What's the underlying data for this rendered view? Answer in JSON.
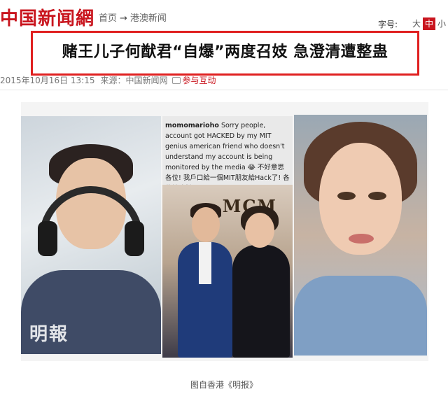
{
  "site": {
    "logo": "中国新闻網"
  },
  "breadcrumb": {
    "home": "首页",
    "separator": "→",
    "section": "港澳新闻"
  },
  "font_size": {
    "label": "字号:",
    "options": [
      "大",
      "中",
      "小"
    ],
    "selected": "中"
  },
  "article": {
    "headline": "赌王儿子何猷君“自爆”两度召妓 急澄清遭整蛊",
    "date": "2015年10月16日 13:15",
    "source": "来源：中国新闻网",
    "comment_link": "参与互动"
  },
  "image": {
    "instagram_user": "momomarioho",
    "instagram_caption": "Sorry people, account got HACKED by my MIT genius american friend who doesn't understand my account is being monitored by the media 😂 不好意思各位! 我戶口給一個MIT朋友給Hack了! 各位請冷靜! #MIT",
    "backdrop_logo": "MCM",
    "watermark": "明報",
    "credit": "图自香港《明报》"
  },
  "colors": {
    "brand_red": "#c9151e",
    "highlight_border": "#e02020"
  }
}
